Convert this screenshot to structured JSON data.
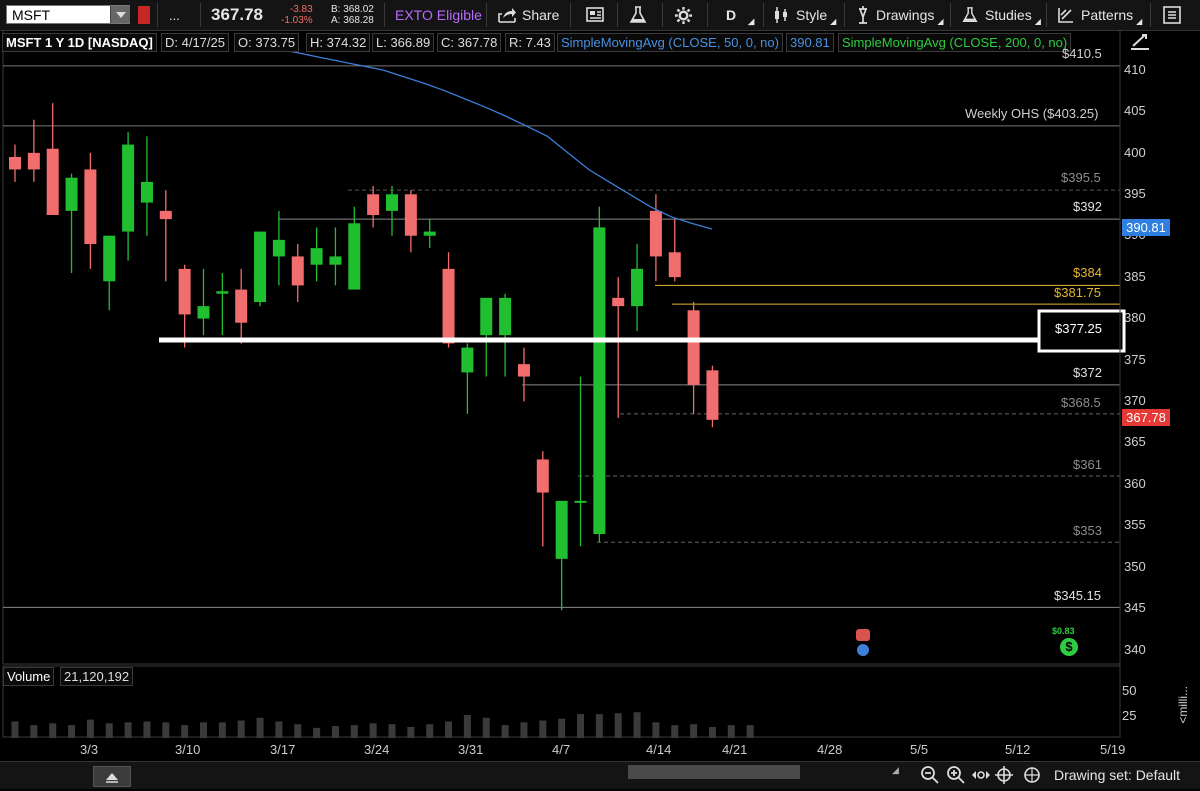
{
  "toolbar": {
    "symbol": "MSFT",
    "more": "...",
    "last_price": "367.78",
    "change": "-3.83",
    "change_pct": "-1.03%",
    "bid": "B: 368.02",
    "ask": "A: 368.28",
    "exto": "EXTO Eligible",
    "share": "Share",
    "timeframe": "D",
    "style": "Style",
    "drawings": "Drawings",
    "studies": "Studies",
    "patterns": "Patterns"
  },
  "infobar": {
    "title": "MSFT 1 Y 1D [NASDAQ]",
    "date": "D: 4/17/25",
    "open": "O: 373.75",
    "high": "H: 374.32",
    "low": "L: 366.89",
    "close": "C: 367.78",
    "range": "R: 7.43",
    "sma50": "SimpleMovingAvg (CLOSE, 50, 0, no)",
    "sma50_value": "390.81",
    "sma200": "SimpleMovingAvg (CLOSE, 200, 0, no)"
  },
  "price_axis": [
    "410",
    "405",
    "400",
    "395",
    "390",
    "385",
    "380",
    "375",
    "370",
    "365",
    "360",
    "355",
    "350",
    "345",
    "340"
  ],
  "price_axis_top_partial": "$410.5",
  "level_labels": [
    {
      "text": "Weekly OHS ($403.25)",
      "color": "#cfcfcf"
    },
    {
      "text": "$395.5",
      "color": "#8c8c8c"
    },
    {
      "text": "$392",
      "color": "#e0e0e0"
    },
    {
      "text": "$384",
      "color": "#e5b62e"
    },
    {
      "text": "$381.75",
      "color": "#e5b62e"
    },
    {
      "text": "$377.25",
      "color": "#ffffff"
    },
    {
      "text": "$372",
      "color": "#e0e0e0"
    },
    {
      "text": "$368.5",
      "color": "#8c8c8c"
    },
    {
      "text": "$361",
      "color": "#8c8c8c"
    },
    {
      "text": "$353",
      "color": "#8c8c8c"
    },
    {
      "text": "$345.15",
      "color": "#e0e0e0"
    }
  ],
  "price_tags": {
    "sma50": "390.81",
    "last": "367.78"
  },
  "events": {
    "dividend": "$0.83"
  },
  "volume": {
    "label": "Volume",
    "value": "21,120,192",
    "axis": [
      "50",
      "25"
    ],
    "axis_unit": "<milli..."
  },
  "dates": [
    "3/3",
    "3/10",
    "3/17",
    "3/24",
    "3/31",
    "4/7",
    "4/14",
    "4/21",
    "4/28",
    "5/5",
    "5/12",
    "5/19"
  ],
  "bottom": {
    "drawing_set": "Drawing set: Default"
  },
  "colors": {
    "up": "#1fbf2f",
    "down": "#f26d6d",
    "sma50": "#3d7fd9",
    "sma200": "#2ecc40",
    "level_gold": "#e5b62e"
  },
  "chart_data": {
    "type": "candlestick",
    "title": "MSFT 1 Y 1D [NASDAQ]",
    "ylim": [
      338,
      411
    ],
    "candles": [
      {
        "date": "2/26",
        "o": 399.5,
        "h": 401.0,
        "l": 396.5,
        "c": 398.0
      },
      {
        "date": "2/27",
        "o": 400.0,
        "h": 404.0,
        "l": 396.5,
        "c": 398.0
      },
      {
        "date": "2/28",
        "o": 400.5,
        "h": 406.0,
        "l": 392.5,
        "c": 392.5
      },
      {
        "date": "3/3",
        "o": 393.0,
        "h": 397.5,
        "l": 385.5,
        "c": 397.0
      },
      {
        "date": "3/4",
        "o": 398.0,
        "h": 400.0,
        "l": 386.0,
        "c": 389.0
      },
      {
        "date": "3/5",
        "o": 384.5,
        "h": 390.0,
        "l": 381.0,
        "c": 390.0
      },
      {
        "date": "3/6",
        "o": 390.5,
        "h": 402.5,
        "l": 387.0,
        "c": 401.0
      },
      {
        "date": "3/7",
        "o": 394.0,
        "h": 402.0,
        "l": 390.0,
        "c": 396.5
      },
      {
        "date": "3/10",
        "o": 393.0,
        "h": 395.5,
        "l": 384.5,
        "c": 392.0
      },
      {
        "date": "3/11",
        "o": 386.0,
        "h": 386.5,
        "l": 376.5,
        "c": 380.5
      },
      {
        "date": "3/12",
        "o": 380.0,
        "h": 386.0,
        "l": 378.0,
        "c": 381.5
      },
      {
        "date": "3/13",
        "o": 383.0,
        "h": 385.5,
        "l": 378.0,
        "c": 383.3
      },
      {
        "date": "3/14",
        "o": 383.5,
        "h": 386.0,
        "l": 377.0,
        "c": 379.5
      },
      {
        "date": "3/17",
        "o": 382.0,
        "h": 390.0,
        "l": 381.5,
        "c": 390.5
      },
      {
        "date": "3/18",
        "o": 387.5,
        "h": 393.0,
        "l": 384.0,
        "c": 389.5
      },
      {
        "date": "3/19",
        "o": 387.5,
        "h": 389.0,
        "l": 382.0,
        "c": 384.0
      },
      {
        "date": "3/20",
        "o": 386.5,
        "h": 391.0,
        "l": 384.5,
        "c": 388.5
      },
      {
        "date": "3/21",
        "o": 386.5,
        "h": 391.0,
        "l": 384.0,
        "c": 387.5
      },
      {
        "date": "3/24",
        "o": 383.5,
        "h": 393.5,
        "l": 383.5,
        "c": 391.5
      },
      {
        "date": "3/25",
        "o": 395.0,
        "h": 396.0,
        "l": 391.0,
        "c": 392.5
      },
      {
        "date": "3/26",
        "o": 393.0,
        "h": 396.0,
        "l": 390.0,
        "c": 395.0
      },
      {
        "date": "3/27",
        "o": 395.0,
        "h": 395.5,
        "l": 388.0,
        "c": 390.0
      },
      {
        "date": "3/28",
        "o": 390.0,
        "h": 392.0,
        "l": 388.5,
        "c": 390.5
      },
      {
        "date": "3/31",
        "o": 386.0,
        "h": 388.0,
        "l": 376.5,
        "c": 377.0
      },
      {
        "date": "4/1",
        "o": 373.5,
        "h": 377.0,
        "l": 368.5,
        "c": 376.5
      },
      {
        "date": "4/2",
        "o": 378.0,
        "h": 382.5,
        "l": 373.0,
        "c": 382.5
      },
      {
        "date": "4/3",
        "o": 378.0,
        "h": 383.0,
        "l": 373.0,
        "c": 382.5
      },
      {
        "date": "4/4",
        "o": 374.5,
        "h": 376.5,
        "l": 370.0,
        "c": 373.0
      },
      {
        "date": "4/7",
        "o": 363.0,
        "h": 364.0,
        "l": 352.5,
        "c": 359.0
      },
      {
        "date": "4/8",
        "o": 351.0,
        "h": 352.0,
        "l": 344.8,
        "c": 358.0
      },
      {
        "date": "4/9",
        "o": 358.0,
        "h": 373.0,
        "l": 352.5,
        "c": 358.0
      },
      {
        "date": "4/10",
        "o": 354.0,
        "h": 393.5,
        "l": 353.0,
        "c": 391.0
      },
      {
        "date": "4/11",
        "o": 382.5,
        "h": 385.0,
        "l": 368.0,
        "c": 381.5
      },
      {
        "date": "4/14",
        "o": 381.5,
        "h": 389.0,
        "l": 378.5,
        "c": 386.0
      },
      {
        "date": "4/15",
        "o": 393.0,
        "h": 395.0,
        "l": 384.5,
        "c": 387.5
      },
      {
        "date": "4/16",
        "o": 388.0,
        "h": 392.0,
        "l": 384.5,
        "c": 385.0
      },
      {
        "date": "4/17",
        "o": 381.0,
        "h": 382.0,
        "l": 368.5,
        "c": 372.0
      },
      {
        "date": "4/18",
        "o": 373.75,
        "h": 374.32,
        "l": 366.89,
        "c": 367.78
      }
    ],
    "sma50": [
      412.5,
      412.0,
      411.5,
      411.0,
      410.5,
      410.0,
      409.2,
      408.4,
      407.5,
      406.5,
      405.5,
      404.4,
      403.2,
      402.0,
      400.0,
      398.0,
      396.5,
      395.0,
      393.5,
      392.3,
      391.5,
      390.81
    ],
    "volume_millions": [
      18,
      14,
      16,
      14,
      20,
      16,
      17,
      18,
      17,
      14,
      17,
      17,
      19,
      22,
      18,
      15,
      11,
      13,
      14,
      16,
      15,
      12,
      15,
      18,
      25,
      22,
      14,
      17,
      19,
      21,
      26,
      26,
      27,
      28,
      17,
      14,
      15,
      12,
      14,
      14
    ],
    "levels": [
      410.5,
      403.25,
      395.5,
      392,
      384,
      381.75,
      377.25,
      372,
      368.5,
      361,
      353,
      345.15
    ]
  }
}
